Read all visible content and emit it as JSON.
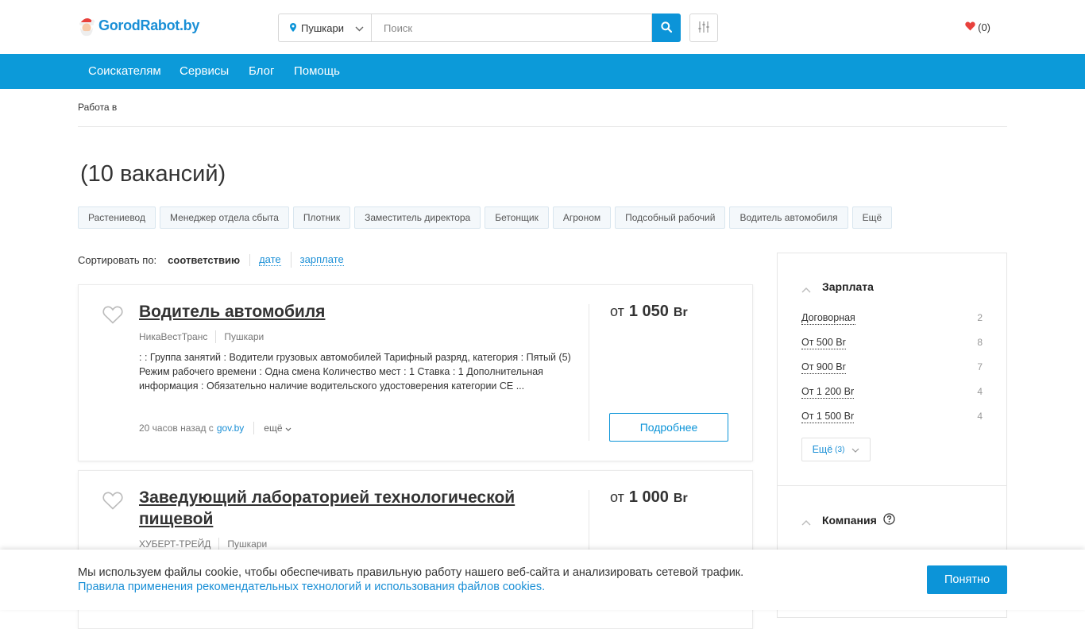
{
  "header": {
    "logo_text": "GorodRabot.by",
    "location": "Пушкари",
    "search_placeholder": "Поиск",
    "favorites_count": "(0)"
  },
  "nav": {
    "items": [
      {
        "label": "Соискателям"
      },
      {
        "label": "Сервисы"
      },
      {
        "label": "Блог"
      },
      {
        "label": "Помощь"
      }
    ]
  },
  "breadcrumb": "Работа в",
  "page_title": "(10 вакансий)",
  "tags": [
    "Растениевод",
    "Менеджер отдела сбыта",
    "Плотник",
    "Заместитель директора",
    "Бетонщик",
    "Агроном",
    "Подсобный рабочий",
    "Водитель автомобиля",
    "Ещё"
  ],
  "sort": {
    "label": "Сортировать по:",
    "current": "соответствию",
    "options": [
      "дате",
      "зарплате"
    ]
  },
  "vacancies": [
    {
      "title": "Водитель автомобиля",
      "company": "НикаВестТранс",
      "city": "Пушкари",
      "description": ": : Группа занятий : Водители грузовых автомобилей Тарифный разряд, категория : Пятый (5) Режим рабочего времени : Одна смена Количество мест : 1 Ставка : 1 Дополнительная информация : Обязательно наличие водительского удостоверения категории CE ...",
      "posted": "20 часов назад с",
      "source": "gov.by",
      "more": "ещё",
      "salary_prefix": "от",
      "salary_value": "1 050",
      "salary_currency": "Br",
      "details_button": "Подробнее"
    },
    {
      "title": "Заведующий лабораторией технологической пищевой",
      "company": "ХУБЕРТ-ТРЕЙД",
      "city": "Пушкари",
      "salary_prefix": "от",
      "salary_value": "1 000",
      "salary_currency": "Br"
    }
  ],
  "sidebar": {
    "salary_title": "Зарплата",
    "salary_rows": [
      {
        "label": "Договорная",
        "count": "2"
      },
      {
        "label": "От 500 Br",
        "count": "8"
      },
      {
        "label": "От 900 Br",
        "count": "7"
      },
      {
        "label": "От 1 200 Br",
        "count": "4"
      },
      {
        "label": "От 1 500 Br",
        "count": "4"
      }
    ],
    "more_label": "Ещё",
    "more_count": "(3)",
    "company_title": "Компания"
  },
  "cookie": {
    "text": "Мы используем файлы cookie, чтобы обеспечивать правильную работу нашего веб-сайта и анализировать сетевой трафик.",
    "link": "Правила применения рекомендательных технологий и использования файлов cookies.",
    "button": "Понятно"
  },
  "colors": {
    "accent": "#0c94d8",
    "nav_bg": "#0c9ad9",
    "heart": "#e8413c"
  }
}
